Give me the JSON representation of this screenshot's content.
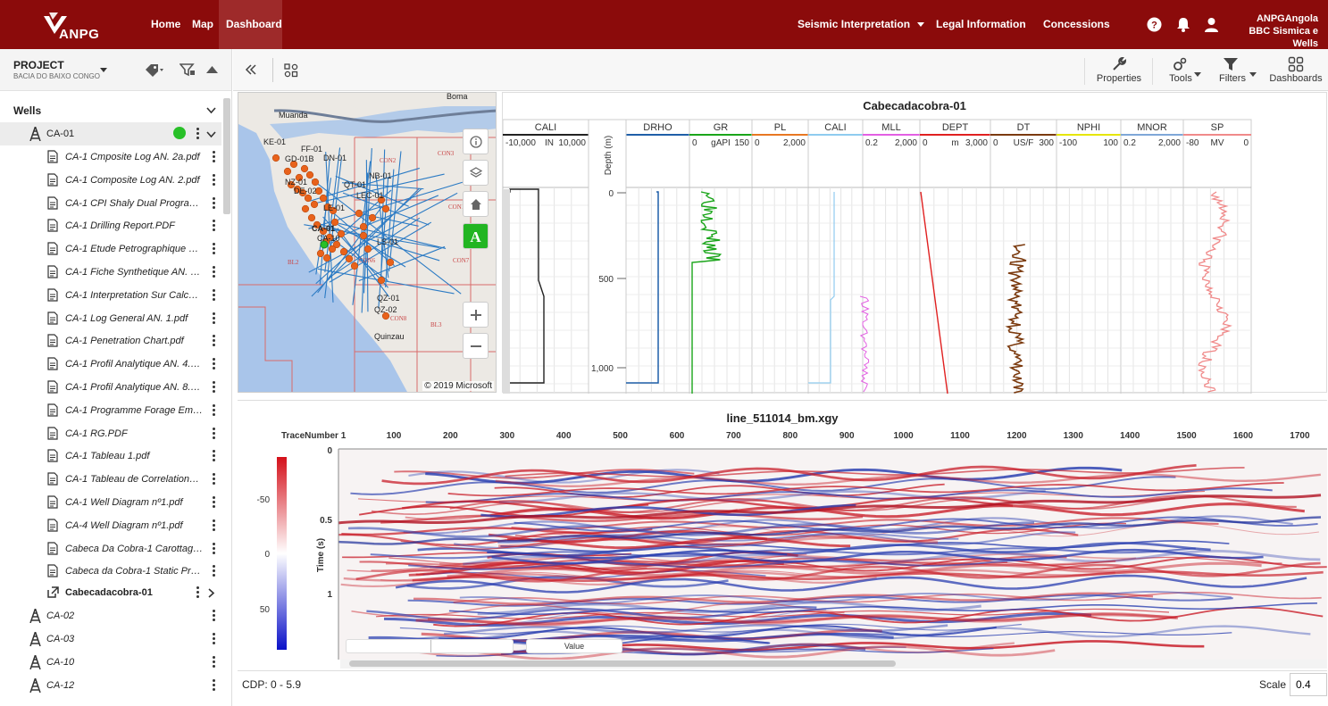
{
  "topbar": {
    "logo_text": "ANPG",
    "nav": [
      "Home",
      "Map",
      "Dashboard"
    ],
    "right_nav": {
      "seismic": "Seismic Interpretation",
      "legal": "Legal Information",
      "concessions": "Concessions"
    },
    "user_line1": "ANPGAngola",
    "user_line2": "BBC Sismica e Wells",
    "brand_color": "#8b0b0b"
  },
  "sidebar": {
    "project_label": "PROJECT",
    "project_sub": "BACIA DO BAIXO CONGO",
    "wells_label": "Wells",
    "selected_well": "CA-01",
    "files": [
      "CA-1 Cmposite Log AN. 2a.pdf",
      "CA-1 Composite Log AN. 2.pdf",
      "CA-1 CPI Shaly Dual Program....",
      "CA-1 Drilling Report.PDF",
      "CA-1 Etude Petrographique De...",
      "CA-1 Fiche Synthetique AN. 3....",
      "CA-1 Interpretation Sur Calcula...",
      "CA-1 Log General AN. 1.pdf",
      "CA-1 Penetration Chart.pdf",
      "CA-1 Profil Analytique AN. 4.pdf",
      "CA-1 Profil Analytique AN. 8.pdf",
      "CA-1 Programme Forage Empl...",
      "CA-1 RG.PDF",
      "CA-1 Tableau 1.pdf",
      "CA-1 Tableau de Correlations ...",
      "CA-1 Well Diagram nº1.pdf",
      "CA-4 Well Diagram nº1.pdf",
      "Cabeca Da Cobra-1 Carottage ...",
      "Cabeca da Cobra-1 Static Pres..."
    ],
    "linked_item": "Cabecadacobra-01",
    "other_wells": [
      "CA-02",
      "CA-03",
      "CA-10",
      "CA-12"
    ]
  },
  "toolbar": {
    "properties": "Properties",
    "tools": "Tools",
    "filters": "Filters",
    "dashboards": "Dashboards"
  },
  "map": {
    "labels": [
      "Boma",
      "Muanda",
      "KE-01",
      "FF-01",
      "GD-01B",
      "DN-01",
      "NZ-01",
      "DE-02",
      "NB-01",
      "QT-01",
      "LEC-01",
      "LE-01",
      "CA-01",
      "CA-10",
      "LS-01",
      "QZ-01",
      "QZ-02",
      "Quinzau"
    ],
    "blocks": [
      "CON2",
      "CON3",
      "CON1",
      "CON7",
      "CON6",
      "BL2",
      "CON8",
      "BL3"
    ],
    "copyright": "© 2019 Microsoft",
    "ctrl_a": "A"
  },
  "log": {
    "title": "Cabecadacobra-01",
    "depth_label": "Depth (m)",
    "depth_ticks": [
      "0",
      "500",
      "1,000"
    ],
    "tracks": [
      {
        "name": "CALI",
        "min": "-10,000",
        "unit": "IN",
        "max": "10,000",
        "color": "#222222"
      },
      {
        "name": "DRHO",
        "min": "",
        "unit": "",
        "max": "",
        "color": "#1f5fa8"
      },
      {
        "name": "GR",
        "min": "0",
        "unit": "gAPI",
        "max": "150",
        "color": "#1aa51a"
      },
      {
        "name": "PL",
        "min": "0",
        "unit": "",
        "max": "2,000",
        "color": "#e87722"
      },
      {
        "name": "CALI",
        "min": "",
        "unit": "",
        "max": "",
        "color": "#8fcbef"
      },
      {
        "name": "MLL",
        "min": "0.2",
        "unit": "",
        "max": "2,000",
        "color": "#e35fe3"
      },
      {
        "name": "DEPT",
        "min": "0",
        "unit": "m",
        "max": "3,000",
        "color": "#e02020"
      },
      {
        "name": "DT",
        "min": "0",
        "unit": "US/F",
        "max": "300",
        "color": "#7b3a0e"
      },
      {
        "name": "NPHI",
        "min": "-100",
        "unit": "",
        "max": "100",
        "color": "#e6e600"
      },
      {
        "name": "MNOR",
        "min": "0.2",
        "unit": "",
        "max": "2,000",
        "color": "#7fa7d8"
      },
      {
        "name": "SP",
        "min": "-80",
        "unit": "MV",
        "max": "0",
        "color": "#f08a8a"
      }
    ]
  },
  "seismic": {
    "title": "line_511014_bm.xgy",
    "trace_label": "TraceNumber 1",
    "trace_ticks": [
      "100",
      "200",
      "300",
      "400",
      "500",
      "600",
      "700",
      "800",
      "900",
      "1000",
      "1100",
      "1200",
      "1300",
      "1400",
      "1500",
      "1600",
      "1700"
    ],
    "time_label": "Time (s)",
    "time_ticks": [
      "0",
      "0.5",
      "1"
    ],
    "colorbar_ticks": [
      "-50",
      "0",
      "50"
    ],
    "value_label": "Value",
    "cdp": "CDP: 0 - 5.9",
    "scale_label": "Scale",
    "scale_value": "0.4"
  }
}
